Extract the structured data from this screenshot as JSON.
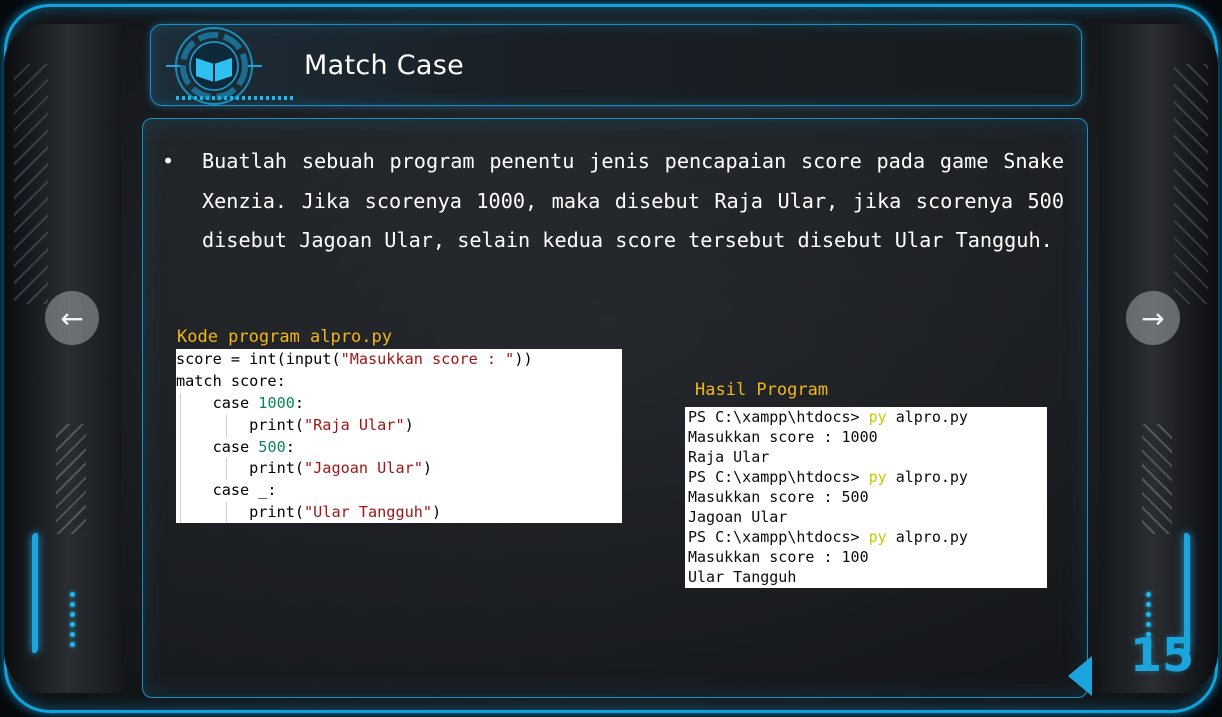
{
  "slide": {
    "title": "Match Case",
    "number": "15",
    "bullet_symbol": "•",
    "bullet_text": "Buatlah sebuah program penentu jenis pencapaian score pada game Snake Xenzia. Jika scorenya 1000, maka disebut Raja Ular, jika scorenya 500 disebut Jagoan Ular, selain kedua score tersebut disebut Ular Tangguh."
  },
  "navigation": {
    "prev_icon": "arrow-left-icon",
    "prev_glyph": "←",
    "next_icon": "arrow-right-icon",
    "next_glyph": "→"
  },
  "code": {
    "caption": "Kode program alpro.py",
    "lines": {
      "l1_a": "score = int(input(",
      "l1_str": "\"Masukkan score : \"",
      "l1_b": "))",
      "l2": "match score:",
      "l3_a": "    case ",
      "l3_num": "1000",
      "l3_b": ":",
      "l4_a": "        print(",
      "l4_str": "\"Raja Ular\"",
      "l4_b": ")",
      "l5_a": "    case ",
      "l5_num": "500",
      "l5_b": ":",
      "l6_a": "        print(",
      "l6_str": "\"Jagoan Ular\"",
      "l6_b": ")",
      "l7": "    case _:",
      "l8_a": "        print(",
      "l8_str": "\"Ular Tangguh\"",
      "l8_b": ")"
    }
  },
  "result": {
    "caption": "Hasil Program",
    "prompt": "PS C:\\xampp\\htdocs> ",
    "cmd": "py",
    "arg": " alpro.py",
    "out1_input": "Masukkan score : 1000",
    "out1_result": "Raja Ular",
    "out2_input": "Masukkan score : 500",
    "out2_result": "Jagoan Ular",
    "out3_input": "Masukkan score : 100",
    "out3_result": "Ular Tangguh"
  },
  "colors": {
    "accent": "#1aa6dd",
    "caption": "#f2b617",
    "string": "#a31515",
    "number": "#098658",
    "terminal_cmd": "#c8c800"
  }
}
